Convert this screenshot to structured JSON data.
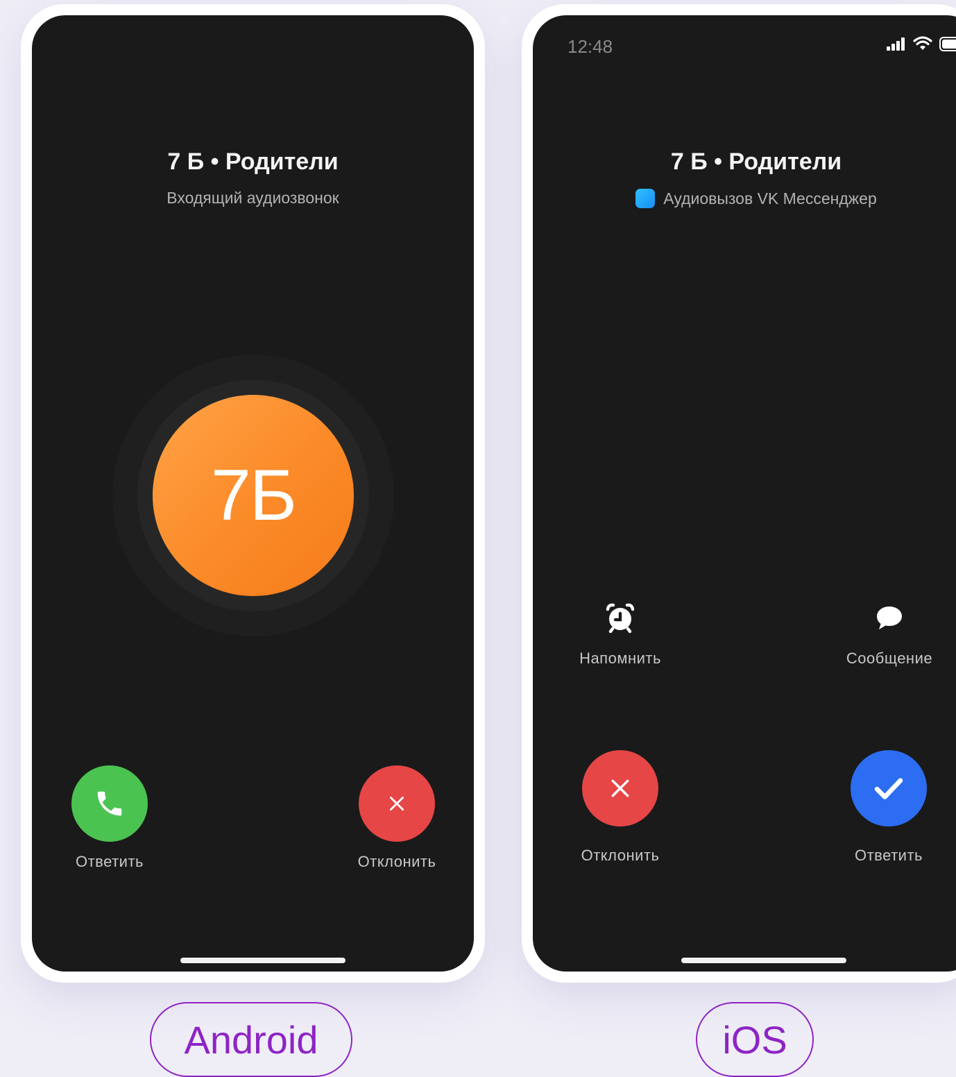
{
  "android": {
    "title": "7 Б • Родители",
    "subtitle": "Входящий аудиозвонок",
    "avatar_text": "7Б",
    "answer_label": "Ответить",
    "decline_label": "Отклонить",
    "platform_label": "Android"
  },
  "ios": {
    "status_time": "12:48",
    "title": "7 Б • Родители",
    "subtitle": "Аудиовызов VK Мессенджер",
    "remind_label": "Напомнить",
    "message_label": "Сообщение",
    "decline_label": "Отклонить",
    "answer_label": "Ответить",
    "platform_label": "iOS"
  },
  "colors": {
    "answer_green": "#4bc351",
    "decline_red": "#e64646",
    "answer_blue": "#2c6df1",
    "avatar_orange": "#fb8a28",
    "tag_purple": "#8e24c4"
  }
}
